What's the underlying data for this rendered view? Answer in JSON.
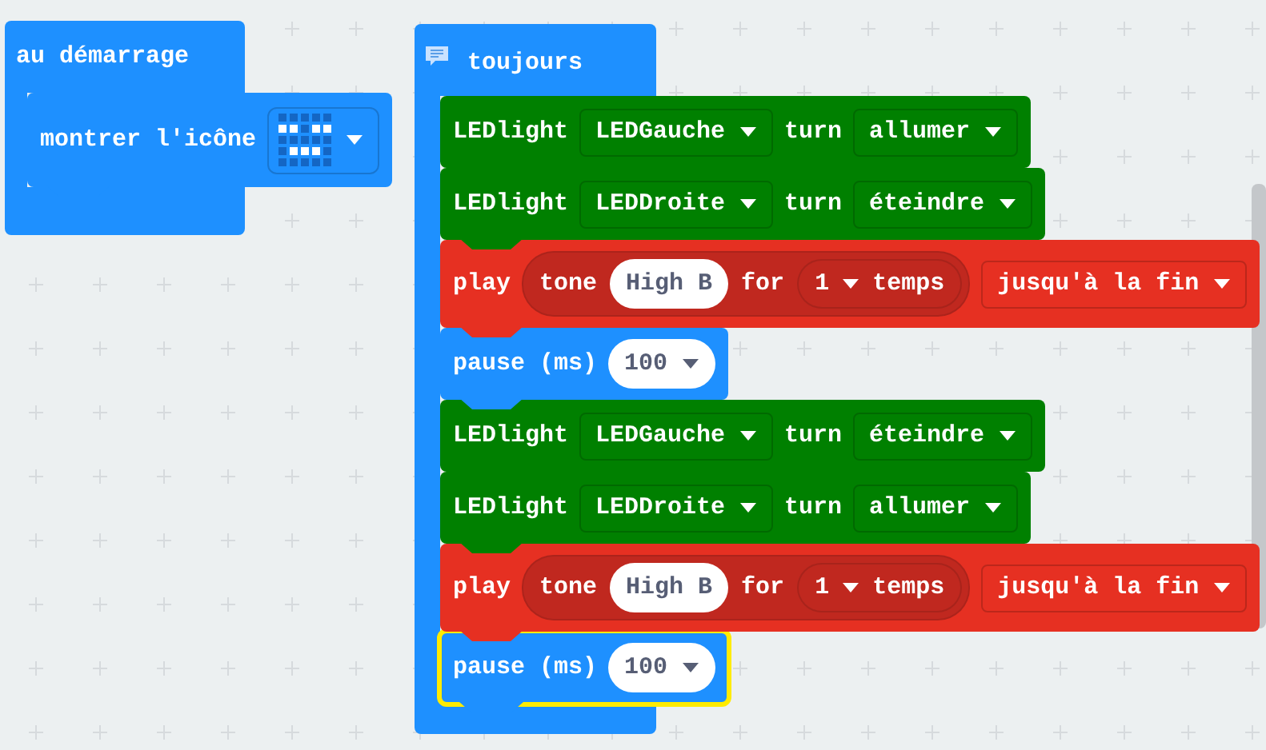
{
  "stacks": [
    {
      "kind": "event",
      "label": "au démarrage",
      "blocks": [
        {
          "kind": "basic",
          "selected": false,
          "parts": [
            {
              "kind": "label",
              "text": "montrer l'icône"
            },
            {
              "kind": "leds",
              "leds": [
                [
                  false,
                  false,
                  false,
                  false,
                  false
                ],
                [
                  true,
                  true,
                  false,
                  true,
                  true
                ],
                [
                  false,
                  false,
                  false,
                  false,
                  false
                ],
                [
                  false,
                  true,
                  true,
                  true,
                  false
                ],
                [
                  false,
                  false,
                  false,
                  false,
                  false
                ]
              ]
            }
          ]
        }
      ]
    },
    {
      "kind": "loop",
      "label": "toujours",
      "blocks": [
        {
          "kind": "led",
          "selected": false,
          "parts": [
            {
              "kind": "label",
              "text": "LEDlight"
            },
            {
              "kind": "dropdown",
              "text": "LEDGauche"
            },
            {
              "kind": "label",
              "text": "turn"
            },
            {
              "kind": "dropdown",
              "text": "allumer"
            }
          ]
        },
        {
          "kind": "led",
          "selected": false,
          "parts": [
            {
              "kind": "label",
              "text": "LEDlight"
            },
            {
              "kind": "dropdown",
              "text": "LEDDroite"
            },
            {
              "kind": "label",
              "text": "turn"
            },
            {
              "kind": "dropdown",
              "text": "éteindre"
            }
          ]
        },
        {
          "kind": "music",
          "selected": false,
          "parts": [
            {
              "kind": "label",
              "text": "play"
            },
            {
              "kind": "group",
              "parts": [
                {
                  "kind": "label",
                  "text": "tone"
                },
                {
                  "kind": "pill",
                  "text": "High B"
                },
                {
                  "kind": "label",
                  "text": "for"
                },
                {
                  "kind": "round_dropdown",
                  "text": "1",
                  "after": "temps"
                }
              ]
            },
            {
              "kind": "dropdown",
              "text": "jusqu'à la fin"
            }
          ]
        },
        {
          "kind": "basic",
          "selected": false,
          "parts": [
            {
              "kind": "label",
              "text": "pause (ms)"
            },
            {
              "kind": "pill_dropdown",
              "text": "100"
            }
          ]
        },
        {
          "kind": "led",
          "selected": false,
          "parts": [
            {
              "kind": "label",
              "text": "LEDlight"
            },
            {
              "kind": "dropdown",
              "text": "LEDGauche"
            },
            {
              "kind": "label",
              "text": "turn"
            },
            {
              "kind": "dropdown",
              "text": "éteindre"
            }
          ]
        },
        {
          "kind": "led",
          "selected": false,
          "parts": [
            {
              "kind": "label",
              "text": "LEDlight"
            },
            {
              "kind": "dropdown",
              "text": "LEDDroite"
            },
            {
              "kind": "label",
              "text": "turn"
            },
            {
              "kind": "dropdown",
              "text": "allumer"
            }
          ]
        },
        {
          "kind": "music",
          "selected": false,
          "parts": [
            {
              "kind": "label",
              "text": "play"
            },
            {
              "kind": "group",
              "parts": [
                {
                  "kind": "label",
                  "text": "tone"
                },
                {
                  "kind": "pill",
                  "text": "High B"
                },
                {
                  "kind": "label",
                  "text": "for"
                },
                {
                  "kind": "round_dropdown",
                  "text": "1",
                  "after": "temps"
                }
              ]
            },
            {
              "kind": "dropdown",
              "text": "jusqu'à la fin"
            }
          ]
        },
        {
          "kind": "basic",
          "selected": true,
          "parts": [
            {
              "kind": "label",
              "text": "pause (ms)"
            },
            {
              "kind": "pill_dropdown",
              "text": "100"
            }
          ]
        }
      ]
    }
  ]
}
